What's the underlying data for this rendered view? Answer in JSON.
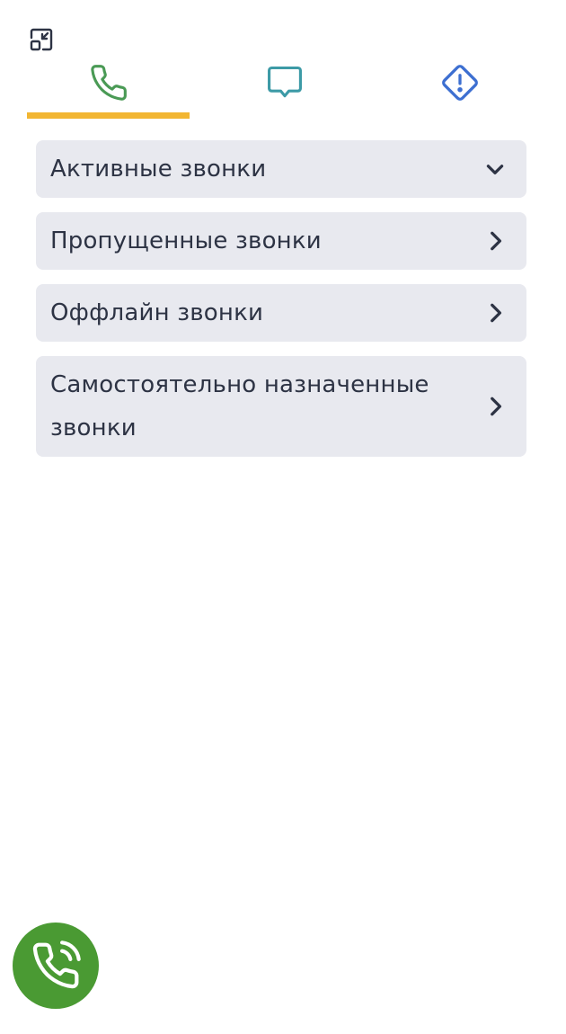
{
  "icons": {
    "minimize": "minimize-icon",
    "tab_calls": "phone-icon",
    "tab_chats": "chat-bubble-icon",
    "tab_alerts": "warning-diamond-icon",
    "expanded": "chevron-down-icon",
    "collapsed": "chevron-right-icon",
    "fab": "phone-ringing-icon"
  },
  "colors": {
    "phone_tab": "#4a9a55",
    "chat_tab": "#3c9aa6",
    "alert_tab": "#3d6fd1",
    "active_underline": "#f2b632",
    "item_bg": "#e8e9ef",
    "text": "#2d3344",
    "fab_bg": "#4a9a33"
  },
  "tabs": [
    {
      "id": "calls",
      "active": true
    },
    {
      "id": "chats",
      "active": false
    },
    {
      "id": "alerts",
      "active": false
    }
  ],
  "sections": [
    {
      "label": "Активные звонки",
      "expanded": true
    },
    {
      "label": "Пропущенные звонки",
      "expanded": false
    },
    {
      "label": "Оффлайн звонки",
      "expanded": false
    },
    {
      "label": "Самостоятельно назначенные звонки",
      "expanded": false
    }
  ]
}
